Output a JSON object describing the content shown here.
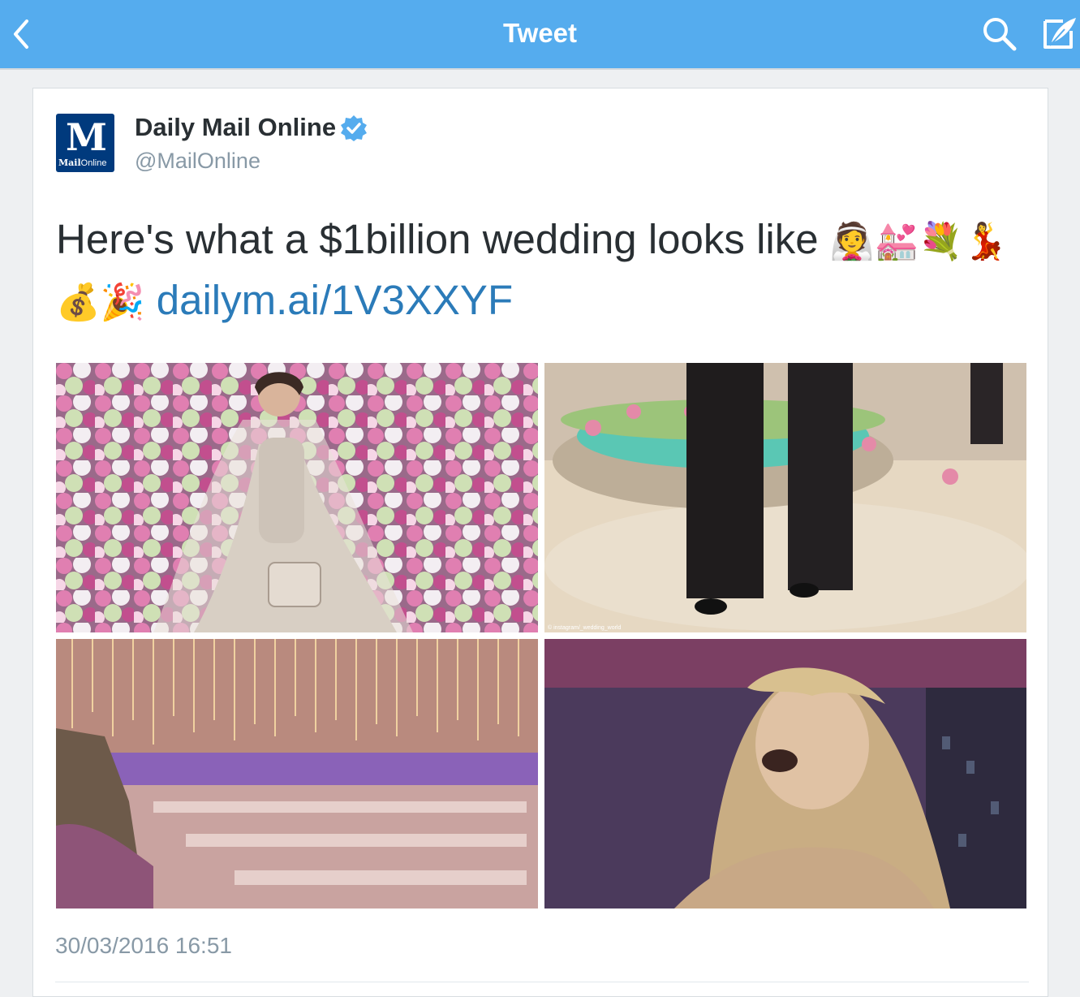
{
  "nav": {
    "title": "Tweet",
    "back_icon": "chevron-left-icon",
    "search_icon": "search-icon",
    "compose_icon": "compose-icon",
    "bar_color": "#55acee"
  },
  "tweet": {
    "author_name": "Daily Mail Online",
    "author_handle": "@MailOnline",
    "avatar_logo_letter": "M",
    "avatar_logo_word_bold": "Mail",
    "avatar_logo_word": "Online",
    "verified": true,
    "text": "Here's what a $1billion wedding looks like",
    "emojis_line1": "👰💒💐💃",
    "emojis_line2": "💰🎉",
    "link": "dailym.ai/1V3XXYF",
    "link_color": "#2b7bb9",
    "timestamp": "30/03/2016 16:51",
    "photos": [
      {
        "subject": "bride in white gown in front of flower wall"
      },
      {
        "subject": "men in black suits by a floral fountain",
        "credit": "© instagram/_wedding_world"
      },
      {
        "subject": "banquet hall with hanging lights and long tables"
      },
      {
        "subject": "blonde singer performing on stage"
      }
    ]
  }
}
